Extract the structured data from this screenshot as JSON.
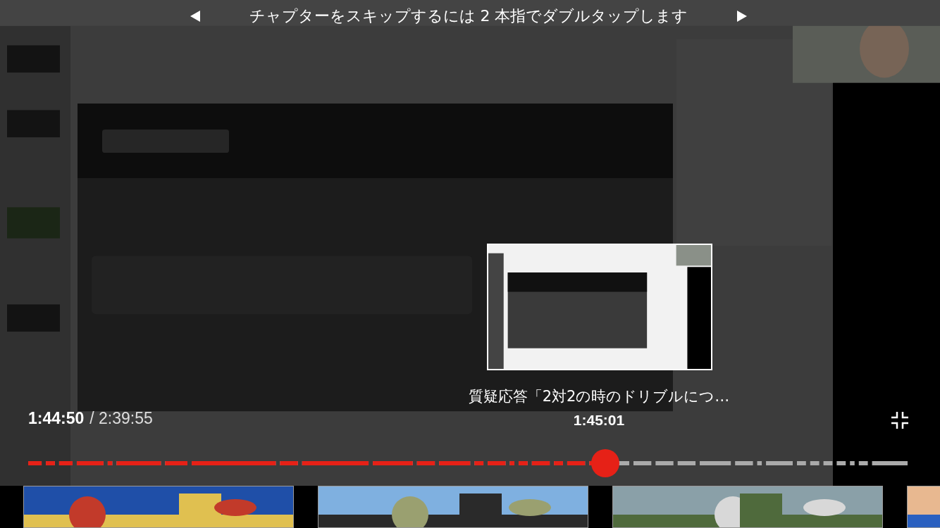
{
  "hint": {
    "text": "チャプターをスキップするには 2 本指でダブルタップします"
  },
  "player": {
    "current_time": "1:44:50",
    "duration": "/ 2:39:55",
    "progress": {
      "level": 0.653
    },
    "preview": {
      "chapter_title": "質疑応答「2対2の時のドリブルにつ…",
      "time": "1:45:01"
    }
  }
}
